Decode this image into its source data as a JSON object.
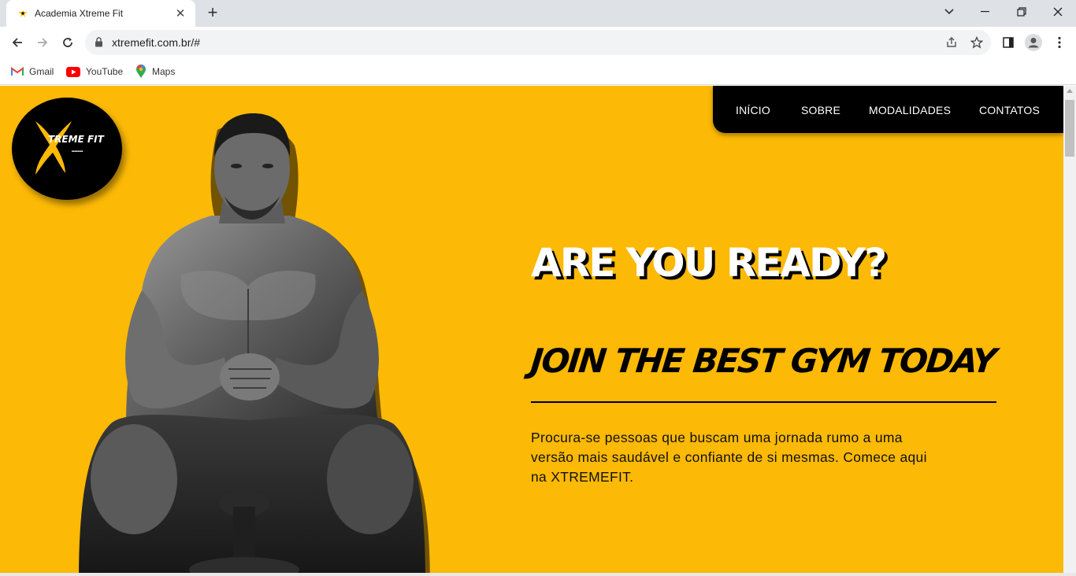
{
  "browser": {
    "tab_title": "Academia Xtreme Fit",
    "url": "xtremefit.com.br/#",
    "bookmarks": [
      {
        "label": "Gmail",
        "icon": "gmail-icon"
      },
      {
        "label": "YouTube",
        "icon": "youtube-icon"
      },
      {
        "label": "Maps",
        "icon": "maps-icon"
      }
    ]
  },
  "site": {
    "logo_text": "TREME FIT",
    "nav": [
      "INÍCIO",
      "SOBRE",
      "MODALIDADES",
      "CONTATOS"
    ],
    "headline": "ARE YOU READY?",
    "subheadline": "JOIN THE BEST GYM TODAY",
    "paragraph": "Procura-se pessoas que buscam uma jornada rumo a uma versão mais saudável e confiante de si mesmas. Comece aqui na XTREMEFIT.",
    "colors": {
      "accent": "#fcb906",
      "dark": "#000000",
      "light": "#ffffff"
    }
  }
}
